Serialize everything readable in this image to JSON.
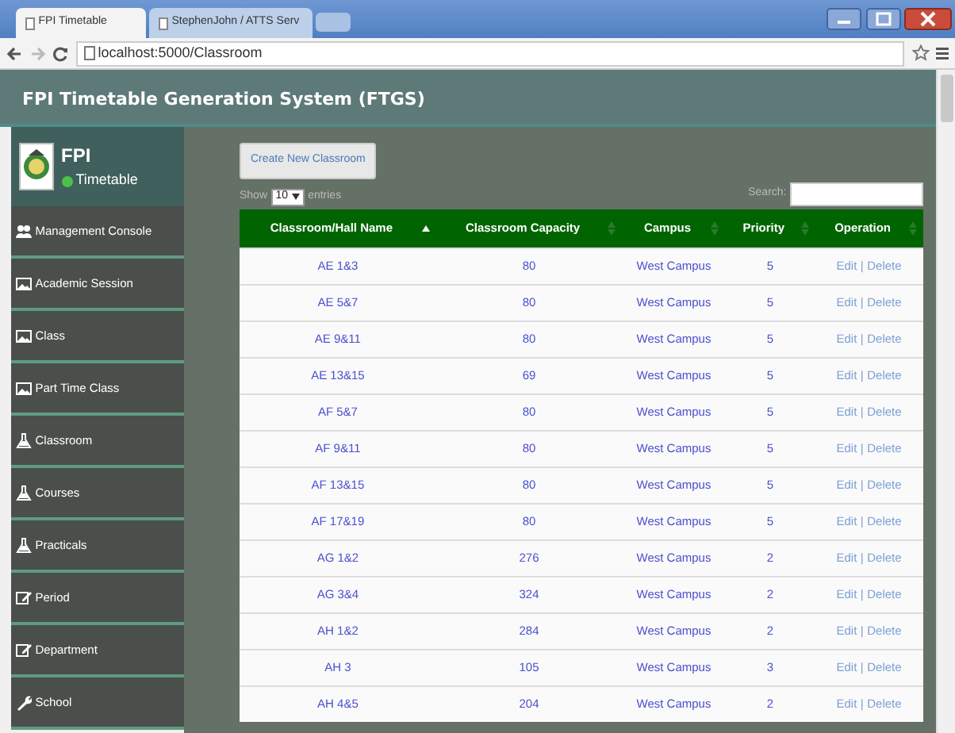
{
  "browser": {
    "tabs": [
      {
        "title": "FPI Timetable",
        "selected": true
      },
      {
        "title": "StephenJohn / ATTS Serv",
        "selected": false
      }
    ],
    "address": "localhost:5000/Classroom"
  },
  "header": {
    "title": "FPI Timetable Generation System (FTGS)"
  },
  "brand": {
    "name": "FPI",
    "status": "Timetable",
    "online": true
  },
  "sidebar": {
    "items": [
      {
        "label": "Management Console",
        "kind": "users"
      },
      {
        "label": "Academic Session",
        "kind": "picture"
      },
      {
        "label": "Class",
        "kind": "picture"
      },
      {
        "label": "Part Time Class",
        "kind": "picture"
      },
      {
        "label": "Classroom",
        "kind": "flask"
      },
      {
        "label": "Courses",
        "kind": "flask"
      },
      {
        "label": "Practicals",
        "kind": "flask"
      },
      {
        "label": "Period",
        "kind": "pencil"
      },
      {
        "label": "Department",
        "kind": "pencil"
      },
      {
        "label": "School",
        "kind": "wrench"
      }
    ]
  },
  "create_button": "Create New Classroom",
  "length": {
    "before": "Show",
    "value": "10",
    "after": "entries"
  },
  "search": {
    "label": "Search:"
  },
  "table": {
    "columns": [
      {
        "label": "Classroom/Hall Name",
        "sorted": true
      },
      {
        "label": "Classroom Capacity",
        "sorted": false
      },
      {
        "label": "Campus",
        "sorted": false
      },
      {
        "label": "Priority",
        "sorted": false
      },
      {
        "label": "Operation",
        "sorted": false
      }
    ],
    "rows": [
      {
        "cells": [
          "AE 1&3",
          "80",
          "West Campus",
          "5"
        ],
        "edit": "Edit",
        "separator": "|",
        "delete": "Delete"
      },
      {
        "cells": [
          "AE 5&7",
          "80",
          "West Campus",
          "5"
        ],
        "edit": "Edit",
        "separator": "|",
        "delete": "Delete"
      },
      {
        "cells": [
          "AE 9&11",
          "80",
          "West Campus",
          "5"
        ],
        "edit": "Edit",
        "separator": "|",
        "delete": "Delete"
      },
      {
        "cells": [
          "AE 13&15",
          "69",
          "West Campus",
          "5"
        ],
        "edit": "Edit",
        "separator": "|",
        "delete": "Delete"
      },
      {
        "cells": [
          "AF 5&7",
          "80",
          "West Campus",
          "5"
        ],
        "edit": "Edit",
        "separator": "|",
        "delete": "Delete"
      },
      {
        "cells": [
          "AF 9&11",
          "80",
          "West Campus",
          "5"
        ],
        "edit": "Edit",
        "separator": "|",
        "delete": "Delete"
      },
      {
        "cells": [
          "AF 13&15",
          "80",
          "West Campus",
          "5"
        ],
        "edit": "Edit",
        "separator": "|",
        "delete": "Delete"
      },
      {
        "cells": [
          "AF 17&19",
          "80",
          "West Campus",
          "5"
        ],
        "edit": "Edit",
        "separator": "|",
        "delete": "Delete"
      },
      {
        "cells": [
          "AG 1&2",
          "276",
          "West Campus",
          "2"
        ],
        "edit": "Edit",
        "separator": "|",
        "delete": "Delete"
      },
      {
        "cells": [
          "AG 3&4",
          "324",
          "West Campus",
          "2"
        ],
        "edit": "Edit",
        "separator": "|",
        "delete": "Delete"
      },
      {
        "cells": [
          "AH 1&2",
          "284",
          "West Campus",
          "2"
        ],
        "edit": "Edit",
        "separator": "|",
        "delete": "Delete"
      },
      {
        "cells": [
          "AH 3",
          "105",
          "West Campus",
          "3"
        ],
        "edit": "Edit",
        "separator": "|",
        "delete": "Delete"
      },
      {
        "cells": [
          "AH 4&5",
          "204",
          "West Campus",
          "2"
        ],
        "edit": "Edit",
        "separator": "|",
        "delete": "Delete"
      }
    ]
  }
}
